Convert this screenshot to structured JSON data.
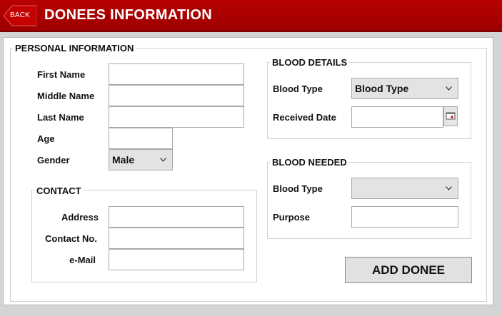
{
  "header": {
    "back_label": "BACK",
    "title": "DONEES INFORMATION",
    "colors": {
      "bar": "#a80000",
      "text": "#ffffff"
    }
  },
  "personal": {
    "legend": "PERSONAL INFORMATION",
    "first_name_label": "First Name",
    "first_name_value": "",
    "middle_name_label": "Middle Name",
    "middle_name_value": "",
    "last_name_label": "Last Name",
    "last_name_value": "",
    "age_label": "Age",
    "age_value": "",
    "gender_label": "Gender",
    "gender_selected": "Male"
  },
  "contact": {
    "legend": "CONTACT",
    "address_label": "Address",
    "address_value": "",
    "contact_no_label": "Contact No.",
    "contact_no_value": "",
    "email_label": "e-Mail",
    "email_value": ""
  },
  "blood_details": {
    "legend": "BLOOD DETAILS",
    "blood_type_label": "Blood Type",
    "blood_type_selected": "Blood Type",
    "received_date_label": "Received Date",
    "received_date_value": "",
    "calendar_icon": "calendar-icon"
  },
  "blood_needed": {
    "legend": "BLOOD NEEDED",
    "blood_type_label": "Blood Type",
    "blood_type_selected": "",
    "purpose_label": "Purpose",
    "purpose_value": ""
  },
  "actions": {
    "add_label": "ADD DONEE"
  }
}
